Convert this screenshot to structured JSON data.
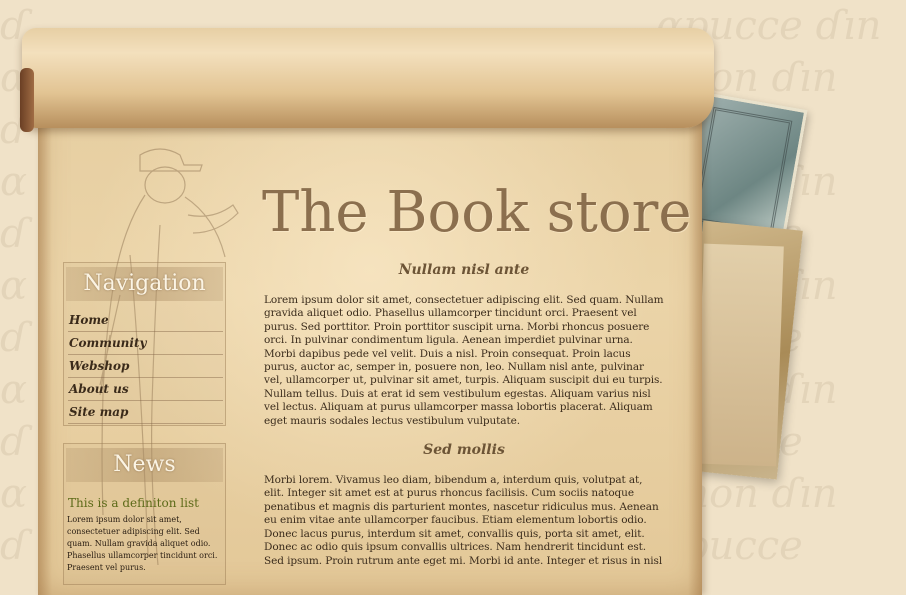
{
  "header": {
    "title": "The Book store"
  },
  "navigation": {
    "title": "Navigation",
    "items": [
      {
        "label": "Home"
      },
      {
        "label": "Community"
      },
      {
        "label": "Webshop"
      },
      {
        "label": "About us"
      },
      {
        "label": "Site map"
      }
    ]
  },
  "news": {
    "title": "News",
    "definition": "This is a definiton list",
    "text": "Lorem ipsum dolor sit amet, consectetuer adipiscing elit. Sed quam. Nullam gravida aliquet odio. Phasellus ullamcorper tincidunt orci. Praesent vel purus."
  },
  "main": {
    "heading1": "Nullam nisl ante",
    "para1": "Lorem ipsum dolor sit amet, consectetuer adipiscing elit. Sed quam. Nullam gravida aliquet odio. Phasellus ullamcorper tincidunt orci. Praesent vel purus. Sed porttitor. Proin porttitor suscipit urna. Morbi rhoncus posuere orci. In pulvinar condimentum ligula. Aenean imperdiet pulvinar urna. Morbi dapibus pede vel velit. Duis a nisl. Proin consequat. Proin lacus purus, auctor ac, semper in, posuere non, leo. Nullam nisl ante, pulvinar vel, ullamcorper ut, pulvinar sit amet, turpis. Aliquam suscipit dui eu turpis. Nullam tellus. Duis at erat id sem vestibulum egestas. Aliquam varius nisl vel lectus. Aliquam at purus ullamcorper massa lobortis placerat. Aliquam eget mauris sodales lectus vestibulum vulputate.",
    "heading2": "Sed mollis",
    "para2": "Morbi lorem. Vivamus leo diam, bibendum a, interdum quis, volutpat at, elit. Integer sit amet est at purus rhoncus facilisis. Cum sociis natoque penatibus et magnis dis parturient montes, nascetur ridiculus mus. Aenean eu enim vitae ante ullamcorper faucibus. Etiam elementum lobortis odio. Donec lacus purus, interdum sit amet, convallis quis, porta sit amet, elit. Donec ac odio quis ipsum convallis ultrices. Nam hendrerit tincidunt est. Sed ipsum. Proin rutrum ante eget mi. Morbi id ante. Integer et risus in nisl"
  }
}
